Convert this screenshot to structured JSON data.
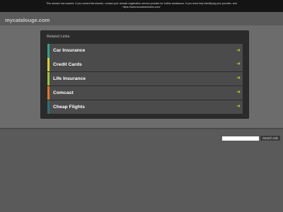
{
  "notice": {
    "line1": "This domain has expired. If you owned this domain, contact your domain registration service provider for further assistance. If you need help identifying your provider, visit",
    "line2": "https://www.tucowsdomains.com/"
  },
  "domain": "mycatalouge.com",
  "panel": {
    "title": "Related Links",
    "links": [
      {
        "label": "Car Insurance",
        "accent": "#3a9d8f"
      },
      {
        "label": "Credit Cards",
        "accent": "#d6d13a"
      },
      {
        "label": "Life Insurance",
        "accent": "#9ec53c"
      },
      {
        "label": "Comcast",
        "accent": "#e0782a"
      },
      {
        "label": "Cheap Flights",
        "accent": "#2e6f77"
      }
    ],
    "arrow_icon": "arrow-right-icon",
    "arrow_color": "#b7d43c"
  },
  "search": {
    "value": "",
    "button_label": "Search Ads"
  },
  "colors": {
    "background": "#5a5a5a",
    "notice_bar": "#141414",
    "panel": "#2b2b2b",
    "link_bg": "#4b4b4b"
  }
}
